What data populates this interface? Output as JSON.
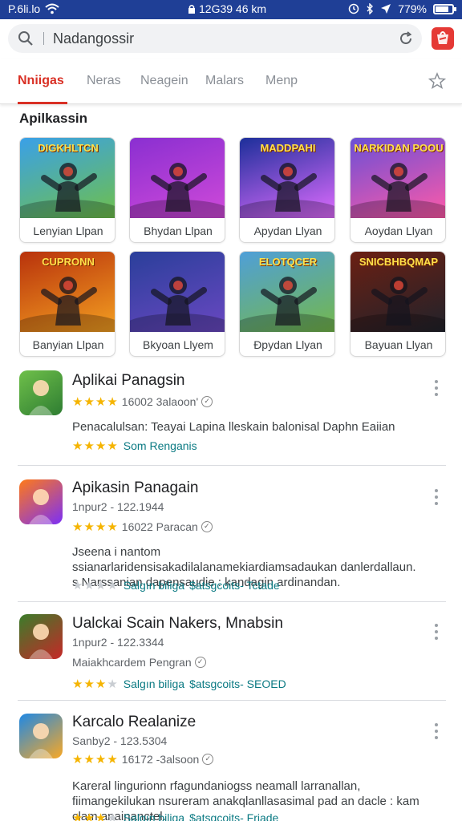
{
  "status_bar": {
    "carrier": "P.6li.lo",
    "center": "12G39 46 km",
    "battery": "779%",
    "battery_level": 0.78
  },
  "search": {
    "value": "Nadangossir",
    "placeholder": "Nadangossir"
  },
  "tabs": [
    {
      "label": "Nniigas",
      "active": true
    },
    {
      "label": "Neras"
    },
    {
      "label": "Neagein"
    },
    {
      "label": "Malars"
    },
    {
      "label": "Menp"
    }
  ],
  "section_title": "Apilkassin",
  "grid": [
    {
      "label": "Lenyian Llpan",
      "art_title": "DIGKHLTCN",
      "colors": [
        "#3aa0e8",
        "#6fc04a"
      ]
    },
    {
      "label": "Bhydan Llpan",
      "art_title": "",
      "colors": [
        "#8a2fd1",
        "#d04ad9"
      ]
    },
    {
      "label": "Apydan Llyan",
      "art_title": "MADDPAHI",
      "colors": [
        "#1c2f9a",
        "#e06cff"
      ]
    },
    {
      "label": "Aoydan Llyan",
      "art_title": "NARKIDAN POOU",
      "colors": [
        "#6a4fd6",
        "#ff5aa8"
      ]
    },
    {
      "label": "Banyian Llpan",
      "art_title": "CUPRONN",
      "colors": [
        "#b8320c",
        "#f4a021"
      ]
    },
    {
      "label": "Bkyoan Llyem",
      "art_title": "",
      "colors": [
        "#2a3f9a",
        "#6a48c2"
      ]
    },
    {
      "label": "Đpydan Llyan",
      "art_title": "ELOTQCER",
      "colors": [
        "#4f9fd8",
        "#74b84a"
      ]
    },
    {
      "label": "Bayuan Llyan",
      "art_title": "SNICBHBQMAP",
      "colors": [
        "#6b2013",
        "#20222b"
      ]
    }
  ],
  "apps": [
    {
      "name": "Aplikai Panagsin",
      "sub": "",
      "stars": 4,
      "rating_text": "16002 3alaoon'",
      "desc": "Penacalulsan: Teayai Lapina lleskain balonisal Daphn Eaiian",
      "tags": [
        "Som Renganis"
      ],
      "tag_stars": 4,
      "icon_colors": [
        "#6fc04a",
        "#2e7d32"
      ]
    },
    {
      "name": "Apikasin Panagain",
      "sub": "1npur2 - 122.1944",
      "stars": 4,
      "rating_text": "16022 Paracan",
      "desc": "Jseena i nantom ssianarlaridensisakadilalanamekiardiamsadaukan danlerdallaun. s Narssanian dapensaudie : kandagin ardinandan.",
      "tags": [
        "Salgın biliga",
        "$atsgcoits- Tctade"
      ],
      "tag_stars": 0,
      "icon_colors": [
        "#ff7a18",
        "#7b2ff7"
      ]
    },
    {
      "name": "Ualckai Scain Nakers, Mnabsin",
      "sub": "1npur2 - 122.3344",
      "stars": 0,
      "rating_text": "Maiakhcardem Pengran",
      "desc": "",
      "tags": [
        "Salgın biliga",
        "$atsgcoits- SEOED"
      ],
      "tag_stars": 3,
      "icon_colors": [
        "#3a7d2a",
        "#c62828"
      ]
    },
    {
      "name": "Karcalo Realanize",
      "sub": "Sanby2 - 123.5304",
      "stars": 4,
      "rating_text": "16172 -3alsoon",
      "desc": "Kareral lingurionn rfagundaniogss neamall larranallan, fiimangekilukan nsureram anakqlanllasasimal pad an dacle : kam clam anainanctel.",
      "tags": [
        "Salgın biliga",
        "$atsgcoits- Friade"
      ],
      "tag_stars": 3,
      "icon_colors": [
        "#1e88e5",
        "#f9a825"
      ]
    }
  ],
  "colors": {
    "accent": "#d93025",
    "status_bar": "#1f3f96",
    "star": "#f5b400",
    "tag": "#0b7a83"
  }
}
